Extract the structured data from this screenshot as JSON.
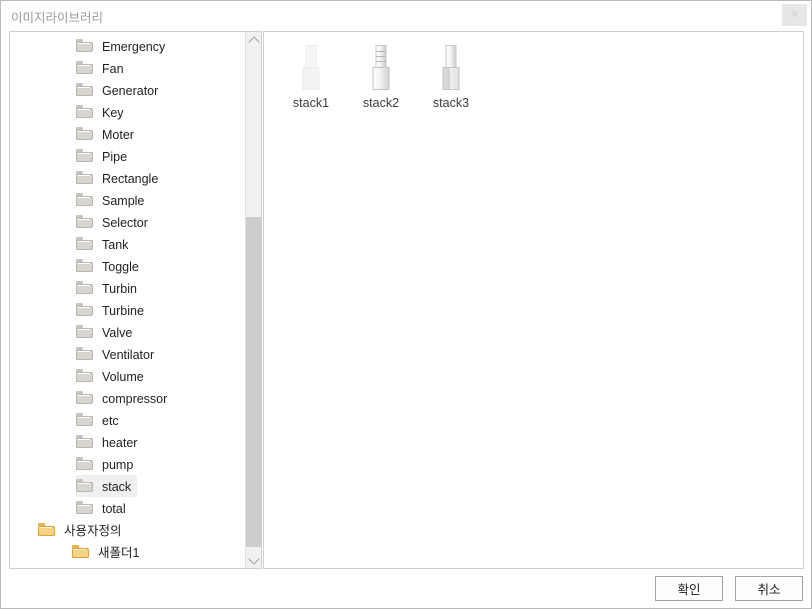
{
  "window": {
    "title": "이미지라이브러리",
    "close_label": "✕",
    "close_icon": "close-icon"
  },
  "tree": {
    "items": [
      {
        "label": "Emergency",
        "icon": "folder-icon",
        "folder_color": "grey",
        "indent": "lvl2",
        "selected": false,
        "expander": false
      },
      {
        "label": "Fan",
        "icon": "folder-icon",
        "folder_color": "grey",
        "indent": "lvl2",
        "selected": false,
        "expander": false
      },
      {
        "label": "Generator",
        "icon": "folder-icon",
        "folder_color": "grey",
        "indent": "lvl2",
        "selected": false,
        "expander": false
      },
      {
        "label": "Key",
        "icon": "folder-icon",
        "folder_color": "grey",
        "indent": "lvl2",
        "selected": false,
        "expander": false
      },
      {
        "label": "Moter",
        "icon": "folder-icon",
        "folder_color": "grey",
        "indent": "lvl2",
        "selected": false,
        "expander": false
      },
      {
        "label": "Pipe",
        "icon": "folder-icon",
        "folder_color": "grey",
        "indent": "lvl2",
        "selected": false,
        "expander": false
      },
      {
        "label": "Rectangle",
        "icon": "folder-icon",
        "folder_color": "grey",
        "indent": "lvl2",
        "selected": false,
        "expander": false
      },
      {
        "label": "Sample",
        "icon": "folder-icon",
        "folder_color": "grey",
        "indent": "lvl2",
        "selected": false,
        "expander": false
      },
      {
        "label": "Selector",
        "icon": "folder-icon",
        "folder_color": "grey",
        "indent": "lvl2",
        "selected": false,
        "expander": false
      },
      {
        "label": "Tank",
        "icon": "folder-icon",
        "folder_color": "grey",
        "indent": "lvl2",
        "selected": false,
        "expander": false
      },
      {
        "label": "Toggle",
        "icon": "folder-icon",
        "folder_color": "grey",
        "indent": "lvl2",
        "selected": false,
        "expander": false
      },
      {
        "label": "Turbin",
        "icon": "folder-icon",
        "folder_color": "grey",
        "indent": "lvl2",
        "selected": false,
        "expander": false
      },
      {
        "label": "Turbine",
        "icon": "folder-icon",
        "folder_color": "grey",
        "indent": "lvl2",
        "selected": false,
        "expander": false
      },
      {
        "label": "Valve",
        "icon": "folder-icon",
        "folder_color": "grey",
        "indent": "lvl2",
        "selected": false,
        "expander": false
      },
      {
        "label": "Ventilator",
        "icon": "folder-icon",
        "folder_color": "grey",
        "indent": "lvl2",
        "selected": false,
        "expander": false
      },
      {
        "label": "Volume",
        "icon": "folder-icon",
        "folder_color": "grey",
        "indent": "lvl2",
        "selected": false,
        "expander": false
      },
      {
        "label": "compressor",
        "icon": "folder-icon",
        "folder_color": "grey",
        "indent": "lvl2",
        "selected": false,
        "expander": false
      },
      {
        "label": "etc",
        "icon": "folder-icon",
        "folder_color": "grey",
        "indent": "lvl2",
        "selected": false,
        "expander": false
      },
      {
        "label": "heater",
        "icon": "folder-icon",
        "folder_color": "grey",
        "indent": "lvl2",
        "selected": false,
        "expander": false
      },
      {
        "label": "pump",
        "icon": "folder-icon",
        "folder_color": "grey",
        "indent": "lvl2",
        "selected": false,
        "expander": false
      },
      {
        "label": "stack",
        "icon": "folder-icon",
        "folder_color": "grey",
        "indent": "lvl2",
        "selected": true,
        "expander": false
      },
      {
        "label": "total",
        "icon": "folder-icon",
        "folder_color": "grey",
        "indent": "lvl2",
        "selected": false,
        "expander": false
      },
      {
        "label": "사용자정의",
        "icon": "folder-icon",
        "folder_color": "gold",
        "indent": "lvl1",
        "selected": false,
        "expander": true
      },
      {
        "label": "새폴더1",
        "icon": "folder-icon",
        "folder_color": "gold",
        "indent": "lvl2sub",
        "selected": false,
        "expander": false
      }
    ],
    "scrollbar": {
      "up_arrow_icon": "chevron-up-icon",
      "down_arrow_icon": "chevron-down-icon",
      "thumb_name": "scrollbar-thumb"
    }
  },
  "content": {
    "thumbnails": [
      {
        "label": "stack1",
        "icon": "stack-icon",
        "variant": "v1"
      },
      {
        "label": "stack2",
        "icon": "stack-icon",
        "variant": "v2"
      },
      {
        "label": "stack3",
        "icon": "stack-icon",
        "variant": "v3"
      }
    ]
  },
  "footer": {
    "ok_label": "확인",
    "cancel_label": "취소"
  },
  "colors": {
    "selection": "#f0f0f0",
    "panel_border": "#cfcfcf",
    "title_text": "#9a9a9a",
    "scrollbar_thumb": "#cdcdcd",
    "folder_grey": "#b9b5b0",
    "folder_gold": "#dfa43a"
  }
}
